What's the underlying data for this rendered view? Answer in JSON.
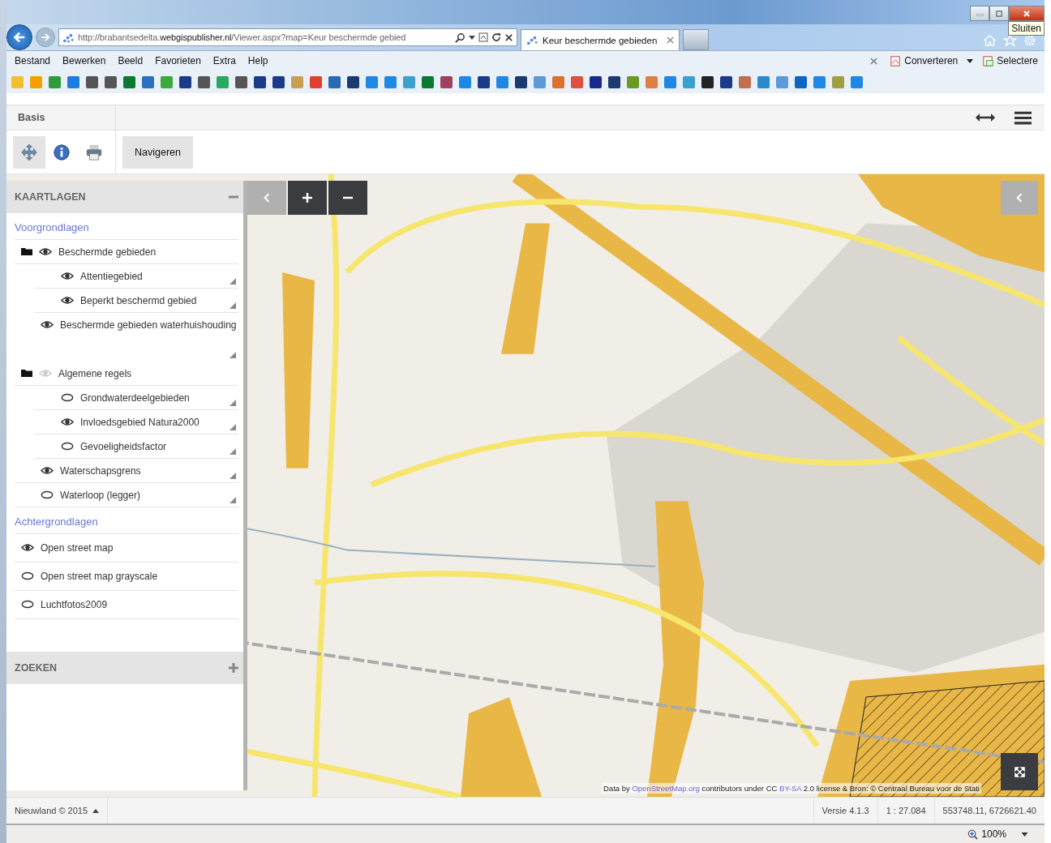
{
  "browser": {
    "address": "http://brabantsedelta.**webgispublisher.nl**/Viewer.aspx?map=Keur beschermde gebied",
    "tab": {
      "label": "Keur beschermde gebieden",
      "selected": true
    },
    "tooltip": "Sluiten",
    "menu": [
      "Bestand",
      "Bewerken",
      "Beeld",
      "Favorieten",
      "Extra",
      "Help"
    ],
    "toolbar_buttons": [
      "Converteren",
      "Selectere"
    ]
  },
  "ribbon": {
    "tab": "Basis",
    "tools": [
      {
        "kind": "pan",
        "selected": true
      },
      {
        "kind": "info",
        "selected": false
      },
      {
        "kind": "print",
        "selected": false
      }
    ],
    "action": "Navigeren"
  },
  "layers_panel": {
    "title": "KAARTLAGEN",
    "expanded": true,
    "sections": [
      {
        "title": "Voorgrondlagen",
        "items": [
          {
            "label": "Beschermde gebieden",
            "kind": "group",
            "visible": true,
            "partial": false,
            "children": [
              {
                "label": "Attentiegebied",
                "kind": "layer",
                "visible": true
              },
              {
                "label": "Beperkt beschermd gebied",
                "kind": "layer",
                "visible": true
              }
            ]
          },
          {
            "label": "Beschermde gebieden waterhuishouding",
            "kind": "layer",
            "visible": true
          },
          {
            "label": "Algemene regels",
            "kind": "group",
            "visible": true,
            "partial": true,
            "children": [
              {
                "label": "Grondwaterdeelgebieden",
                "kind": "layer",
                "visible": false
              },
              {
                "label": "Invloedsgebied Natura2000",
                "kind": "layer",
                "visible": true
              },
              {
                "label": "Gevoeligheidsfactor",
                "kind": "layer",
                "visible": false
              }
            ]
          },
          {
            "label": "Waterschapsgrens",
            "kind": "layer",
            "visible": true
          },
          {
            "label": "Waterloop (legger)",
            "kind": "layer",
            "visible": false
          }
        ]
      },
      {
        "title": "Achtergrondlagen",
        "items": [
          {
            "label": "Open street map",
            "kind": "base",
            "visible": true
          },
          {
            "label": "Open street map grayscale",
            "kind": "base",
            "visible": false
          },
          {
            "label": "Luchtfotos2009",
            "kind": "base",
            "visible": false
          }
        ]
      }
    ]
  },
  "search_panel": {
    "title": "ZOEKEN",
    "expanded": false
  },
  "map": {
    "attribution": {
      "before": "Data by ",
      "link1": "OpenStreetMap.org",
      "middle": " contributors under CC ",
      "link2": "BY-SA",
      "after": " 2.0 license & Bron: © Centraal Bureau voor de Stati"
    }
  },
  "status_bar": {
    "credit": "Nieuwland © 2015",
    "version": "Versie 4.1.3",
    "scale": "1 : 27.084",
    "coordinates": "553748.11, 6726621.40"
  },
  "browser_status": {
    "zoom": "100%"
  }
}
